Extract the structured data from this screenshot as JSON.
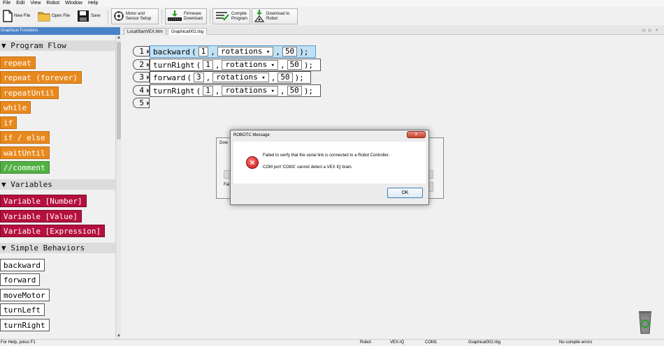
{
  "menu": [
    "File",
    "Edit",
    "View",
    "Robot",
    "Window",
    "Help"
  ],
  "toolbar": {
    "new_file": "New File",
    "open_file": "Open File",
    "save": "Save",
    "motor_sensor": [
      "Motor and",
      "Sensor Setup"
    ],
    "firmware": [
      "Firmware",
      "Download"
    ],
    "compile": [
      "Compile",
      "Program"
    ],
    "download": [
      "Download to",
      "Robot"
    ]
  },
  "left_panel": {
    "title": "Graphical Functions",
    "categories": {
      "program_flow": "▼ Program Flow",
      "variables": "▼ Variables",
      "simple_behaviors": "▼ Simple Behaviors"
    },
    "program_flow_blocks": [
      "repeat",
      "repeat (forever)",
      "repeatUntil",
      "while",
      "if",
      "if / else",
      "waitUntil",
      "//comment"
    ],
    "variable_blocks": [
      "Variable [Number]",
      "Variable [Value]",
      "Variable [Expression]"
    ],
    "behavior_blocks": [
      "backward",
      "forward",
      "moveMotor",
      "turnLeft",
      "turnRight"
    ]
  },
  "tabs": [
    "LocalStartVEX.htm",
    "Graphical002.rbg"
  ],
  "tab_nav": [
    "◁",
    "▷",
    "×"
  ],
  "editor": {
    "line_numbers": [
      "1",
      "2",
      "3",
      "4",
      "5"
    ],
    "lines": [
      {
        "cmd": "backward",
        "open": "(",
        "num": "1",
        "c1": ",",
        "unit": "rotations",
        "c2": ",",
        "speed": "50",
        "close": ");"
      },
      {
        "cmd": "turnRight",
        "open": "(",
        "num": "1",
        "c1": ",",
        "unit": "rotations",
        "c2": ",",
        "speed": "50",
        "close": ");"
      },
      {
        "cmd": "forward",
        "open": "(",
        "num": "3",
        "c1": ",",
        "unit": "rotations",
        "c2": ",",
        "speed": "50",
        "close": ");"
      },
      {
        "cmd": "turnRight",
        "open": "(",
        "num": "1",
        "c1": ",",
        "unit": "rotations",
        "c2": ",",
        "speed": "50",
        "close": ");"
      }
    ]
  },
  "background_dialog": {
    "title": "Dow",
    "partial_text": "Fai"
  },
  "message_dialog": {
    "title": "ROBOTC Message",
    "close": "x",
    "error_glyph": "×",
    "line1": "Failed to verify that the serial link is connected to a Robot Controller.",
    "line2": "COM port 'COM1' cannot detect a VEX IQ brain.",
    "ok": "OK"
  },
  "statusbar": {
    "help": "For Help, press F1",
    "mode": "Robot",
    "platform": "VEX-IQ",
    "port": "COM1",
    "file": "Graphical002.rbg",
    "errors": "No compile errors"
  }
}
